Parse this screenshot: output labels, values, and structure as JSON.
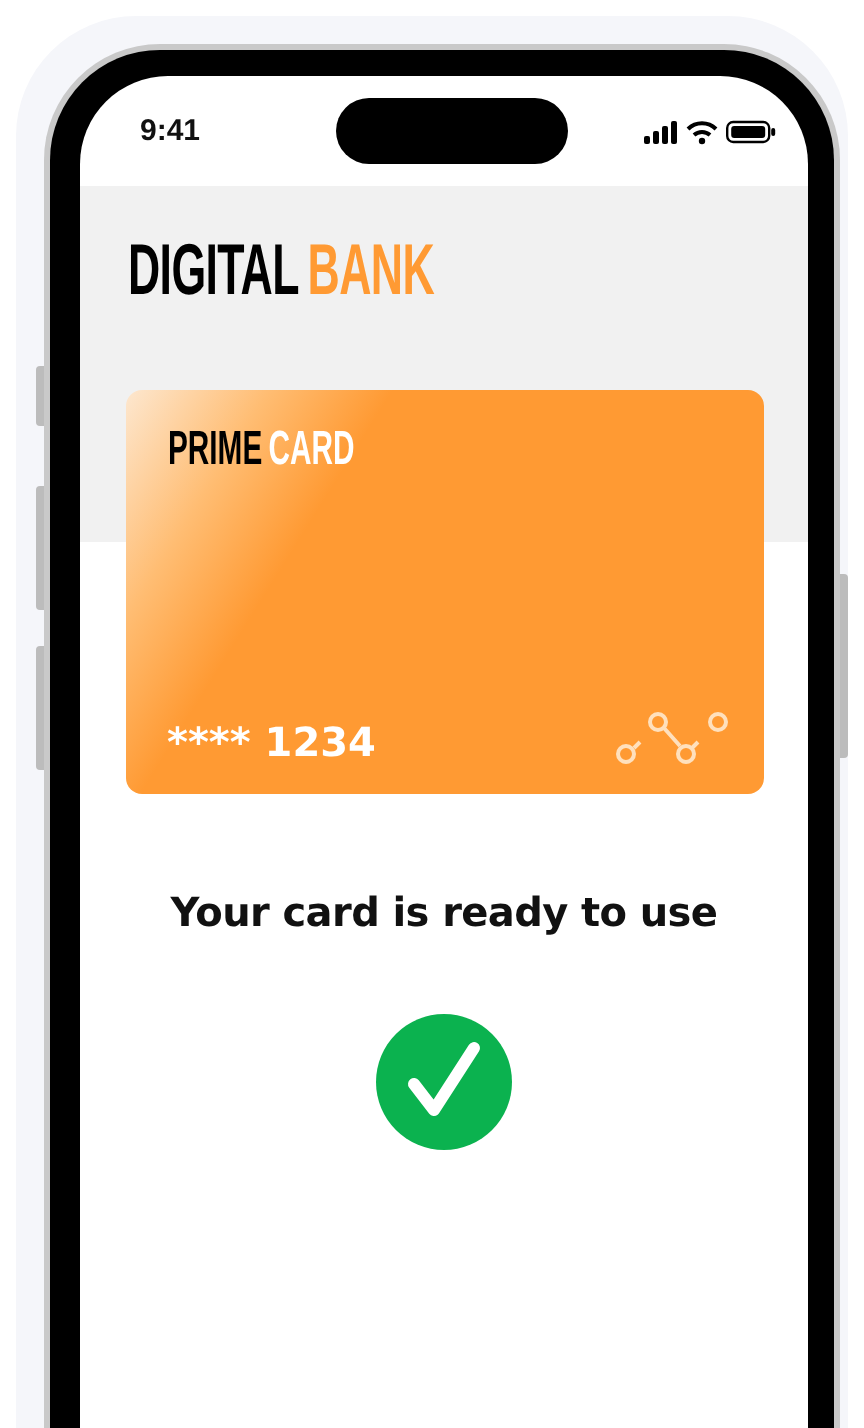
{
  "status_bar": {
    "time": "9:41"
  },
  "app_title": [
    {
      "text": "DIGITAL",
      "kind": "plain"
    },
    {
      "text": "BANK",
      "kind": "accent"
    }
  ],
  "card": {
    "title": [
      {
        "text": "PRIME",
        "kind": "plain"
      },
      {
        "text": "CARD",
        "kind": "light"
      }
    ],
    "number": "**** 1234"
  },
  "message": "Your card is ready to use"
}
